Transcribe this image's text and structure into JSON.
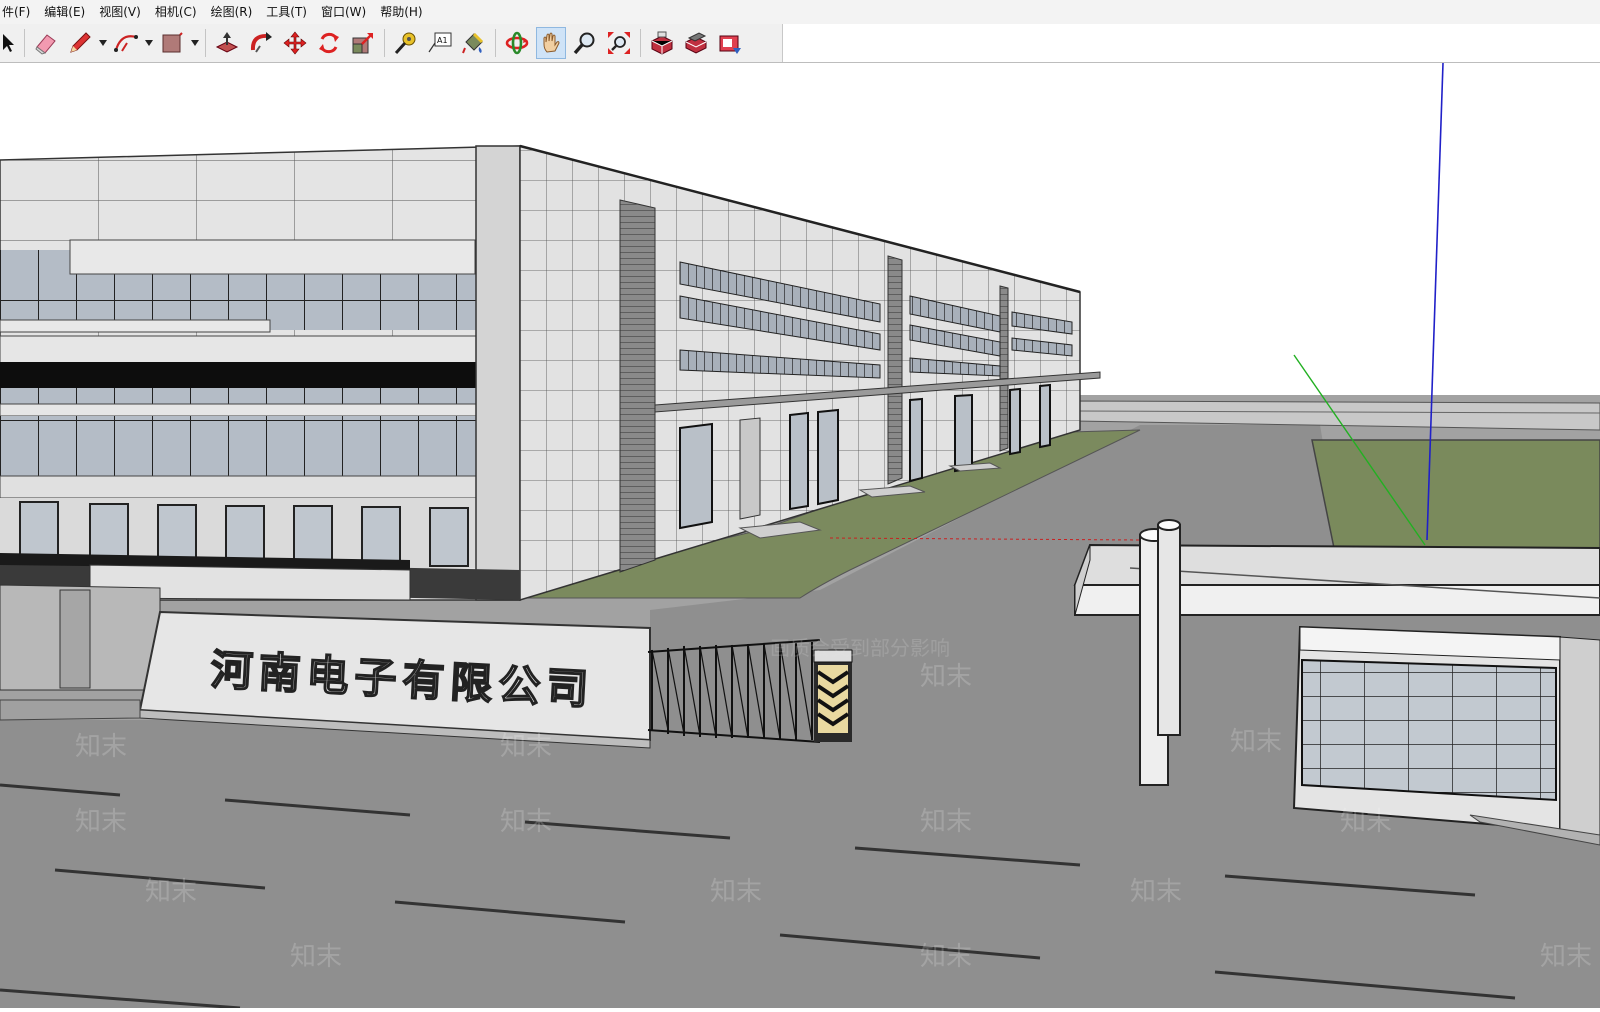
{
  "menu": {
    "items": [
      "件(F)",
      "编辑(E)",
      "视图(V)",
      "相机(C)",
      "绘图(R)",
      "工具(T)",
      "窗口(W)",
      "帮助(H)"
    ]
  },
  "toolbar": {
    "tools": [
      "select-tool",
      "eraser-tool",
      "pencil-tool",
      "arc-tool",
      "rectangle-tool",
      "push-pull-tool",
      "follow-me-tool",
      "move-tool",
      "rotate-tool",
      "scale-tool",
      "tape-measure-tool",
      "text-tool",
      "paint-bucket-tool",
      "orbit-tool",
      "pan-tool",
      "zoom-tool",
      "zoom-extents-tool",
      "warehouse-tool",
      "components-tool",
      "share-tool"
    ],
    "active_tool": "pan-tool",
    "text_tool_label": "A1"
  },
  "scene": {
    "sign_text": "河南电子有限公司",
    "watermark_text": "知末",
    "watermark_notice": "画质会受到部分影响",
    "colors": {
      "sky": "#ffffff",
      "road": "#8d8d8d",
      "lawn": "#7a8a5c",
      "facade": "#e6e6e6",
      "glass": "#b8c0c8",
      "axis_blue": "#2020c8",
      "axis_green": "#20b020",
      "axis_red": "#c82020"
    }
  }
}
